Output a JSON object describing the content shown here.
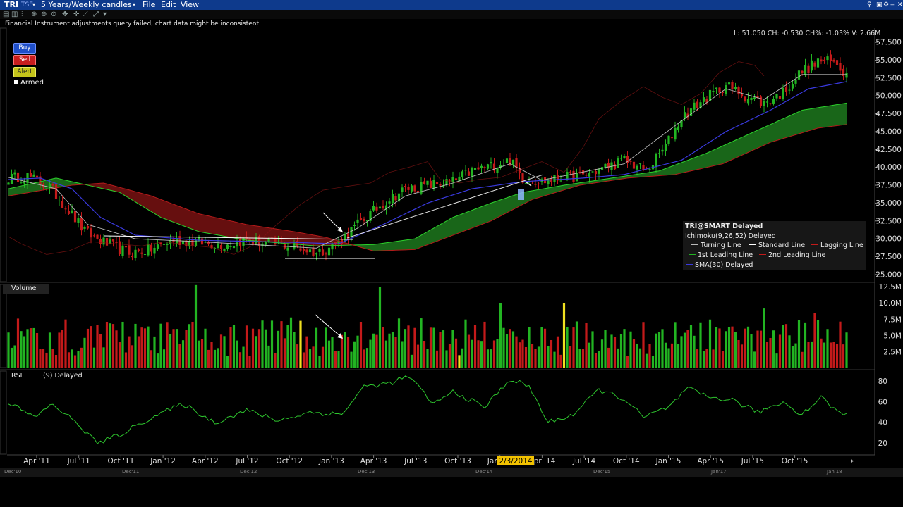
{
  "window": {
    "symbol": "TRI",
    "exchange": "TSE",
    "period": "5 Years/Weekly candles",
    "menu": [
      "File",
      "Edit",
      "View"
    ]
  },
  "warning": "Financial Instrument adjustments query failed, chart data might be inconsistent",
  "order_buttons": {
    "buy": "Buy",
    "sell": "Sell",
    "alert": "Alert",
    "armed": "Armed"
  },
  "ohlc_readout": "L: 51.050 CH: -0.530 CH%: -1.03% V: 2.66M",
  "legend": {
    "title": "TRI@SMART Delayed",
    "ichimoku": "Ichimoku(9,26,52) Delayed",
    "turning": "Turning Line",
    "standard": "Standard Line",
    "lagging": "Lagging Line",
    "leading1": "1st Leading Line",
    "leading2": "2nd Leading Line",
    "sma": "SMA(30) Delayed"
  },
  "volume_label": "Volume",
  "rsi_label": "RSI",
  "rsi_param": "(9) Delayed",
  "crosshair_date": "2/3/2014",
  "bottom_strip": [
    "Dec'10",
    "Dec'11",
    "Dec'12",
    "Dec'13",
    "Dec'14",
    "Dec'15",
    "Jan'17",
    "Jan'18"
  ],
  "colors": {
    "up": "#22b422",
    "down": "#c41a1a",
    "cloud_bull": "#1a6b1a",
    "cloud_bear": "#6b1010",
    "sma": "#3a3ae0",
    "rsi": "#2ec62e",
    "axis": "#dddddd"
  },
  "chart_data": [
    {
      "type": "candlestick",
      "title": "",
      "x_ticks": [
        "Apr '11",
        "Jul '11",
        "Oct '11",
        "Jan '12",
        "Apr '12",
        "Jul '12",
        "Oct '12",
        "Jan '13",
        "Apr '13",
        "Jul '13",
        "Oct '13",
        "Jan '14",
        "Apr '14",
        "Jul '14",
        "Oct '14",
        "Jan '15",
        "Apr '15",
        "Jul '15",
        "Oct '15"
      ],
      "y_ticks": [
        25,
        27.5,
        30,
        32.5,
        35,
        37.5,
        40,
        42.5,
        45,
        47.5,
        50,
        52.5,
        55,
        57.5
      ],
      "ylim": [
        24,
        58.5
      ],
      "close_anchors": [
        [
          0,
          38.5
        ],
        [
          6,
          38.8
        ],
        [
          13,
          37.2
        ],
        [
          19,
          34
        ],
        [
          24,
          31
        ],
        [
          30,
          29.5
        ],
        [
          38,
          28
        ],
        [
          45,
          28.5
        ],
        [
          52,
          29.8
        ],
        [
          60,
          29.5
        ],
        [
          68,
          29.2
        ],
        [
          75,
          29.8
        ],
        [
          83,
          29.3
        ],
        [
          90,
          29
        ],
        [
          97,
          28
        ],
        [
          104,
          29.5
        ],
        [
          110,
          32
        ],
        [
          118,
          35
        ],
        [
          125,
          37
        ],
        [
          132,
          37.5
        ],
        [
          140,
          38
        ],
        [
          146,
          39.5
        ],
        [
          152,
          40.2
        ],
        [
          158,
          41
        ],
        [
          162,
          38.5
        ],
        [
          168,
          38
        ],
        [
          174,
          38.5
        ],
        [
          181,
          38.8
        ],
        [
          188,
          40
        ],
        [
          194,
          41
        ],
        [
          201,
          39.5
        ],
        [
          207,
          43
        ],
        [
          212,
          47
        ],
        [
          219,
          49.5
        ],
        [
          226,
          51.5
        ],
        [
          232,
          50
        ],
        [
          238,
          49
        ],
        [
          244,
          50.5
        ],
        [
          250,
          53.5
        ],
        [
          256,
          55
        ],
        [
          261,
          54.5
        ],
        [
          264,
          53
        ]
      ],
      "sma_anchors": [
        [
          0,
          38.3
        ],
        [
          10,
          38.5
        ],
        [
          20,
          37
        ],
        [
          29,
          33
        ],
        [
          40,
          30.5
        ],
        [
          60,
          29.8
        ],
        [
          90,
          29.5
        ],
        [
          104,
          29.3
        ],
        [
          118,
          32
        ],
        [
          132,
          35
        ],
        [
          146,
          37
        ],
        [
          162,
          38
        ],
        [
          181,
          38.5
        ],
        [
          194,
          39
        ],
        [
          212,
          41
        ],
        [
          226,
          45
        ],
        [
          240,
          48
        ],
        [
          252,
          51
        ],
        [
          264,
          52
        ]
      ],
      "turning_anchors": [
        [
          0,
          38.6
        ],
        [
          15,
          37
        ],
        [
          25,
          32
        ],
        [
          40,
          30
        ],
        [
          60,
          29.6
        ],
        [
          97,
          28.7
        ],
        [
          110,
          31.5
        ],
        [
          125,
          36
        ],
        [
          140,
          37.8
        ],
        [
          158,
          40.5
        ],
        [
          168,
          38.2
        ],
        [
          194,
          40.5
        ],
        [
          212,
          46.5
        ],
        [
          226,
          51
        ],
        [
          238,
          49.5
        ],
        [
          250,
          53
        ],
        [
          264,
          53
        ]
      ],
      "leading_a_anchors": [
        [
          0,
          37
        ],
        [
          15,
          38.5
        ],
        [
          25,
          37.5
        ],
        [
          35,
          36.5
        ],
        [
          48,
          33
        ],
        [
          60,
          31
        ],
        [
          75,
          29.8
        ],
        [
          97,
          29
        ],
        [
          115,
          29.2
        ],
        [
          128,
          30
        ],
        [
          140,
          33
        ],
        [
          152,
          35
        ],
        [
          162,
          36.5
        ],
        [
          175,
          37.5
        ],
        [
          190,
          38.5
        ],
        [
          205,
          39.5
        ],
        [
          220,
          42
        ],
        [
          235,
          45
        ],
        [
          250,
          48
        ],
        [
          264,
          49
        ]
      ],
      "leading_b_anchors": [
        [
          0,
          36
        ],
        [
          20,
          37.5
        ],
        [
          30,
          37.8
        ],
        [
          45,
          36
        ],
        [
          60,
          33.5
        ],
        [
          75,
          32
        ],
        [
          90,
          31
        ],
        [
          100,
          30.2
        ],
        [
          115,
          28.3
        ],
        [
          128,
          28.5
        ],
        [
          140,
          30.5
        ],
        [
          152,
          32.5
        ],
        [
          165,
          35.5
        ],
        [
          180,
          37.5
        ],
        [
          195,
          38.5
        ],
        [
          210,
          39
        ],
        [
          225,
          40.5
        ],
        [
          240,
          43.5
        ],
        [
          255,
          45.5
        ],
        [
          264,
          46
        ]
      ],
      "lagging_span_window": [
        0,
        238
      ]
    },
    {
      "type": "bar",
      "title": "Volume",
      "y_ticks": [
        "2.5M",
        "5.0M",
        "7.5M",
        "10.0M",
        "12.5M"
      ],
      "y_tick_values": [
        2.5,
        5,
        7.5,
        10,
        12.5
      ],
      "ylim": [
        0,
        13
      ],
      "typical_range_millions": [
        3,
        8
      ],
      "spikes_millions": [
        [
          59,
          12.8
        ],
        [
          117,
          12.5
        ],
        [
          155,
          10
        ],
        [
          175,
          10
        ],
        [
          238,
          9.2
        ],
        [
          254,
          8.5
        ]
      ],
      "highlight_bars": [
        92,
        142,
        175
      ]
    },
    {
      "type": "line",
      "title": "RSI",
      "y_ticks": [
        20,
        40,
        60,
        80
      ],
      "ylim": [
        10,
        90
      ],
      "anchors": [
        [
          0,
          60
        ],
        [
          8,
          45
        ],
        [
          14,
          58
        ],
        [
          22,
          38
        ],
        [
          28,
          20
        ],
        [
          35,
          28
        ],
        [
          45,
          45
        ],
        [
          55,
          58
        ],
        [
          65,
          40
        ],
        [
          75,
          52
        ],
        [
          85,
          42
        ],
        [
          95,
          50
        ],
        [
          105,
          48
        ],
        [
          112,
          75
        ],
        [
          120,
          78
        ],
        [
          126,
          85
        ],
        [
          134,
          58
        ],
        [
          140,
          70
        ],
        [
          150,
          55
        ],
        [
          158,
          82
        ],
        [
          164,
          75
        ],
        [
          170,
          40
        ],
        [
          178,
          48
        ],
        [
          186,
          72
        ],
        [
          194,
          63
        ],
        [
          200,
          45
        ],
        [
          208,
          55
        ],
        [
          214,
          73
        ],
        [
          220,
          65
        ],
        [
          228,
          62
        ],
        [
          236,
          50
        ],
        [
          244,
          60
        ],
        [
          250,
          48
        ],
        [
          256,
          65
        ],
        [
          262,
          48
        ],
        [
          264,
          50
        ]
      ]
    }
  ]
}
